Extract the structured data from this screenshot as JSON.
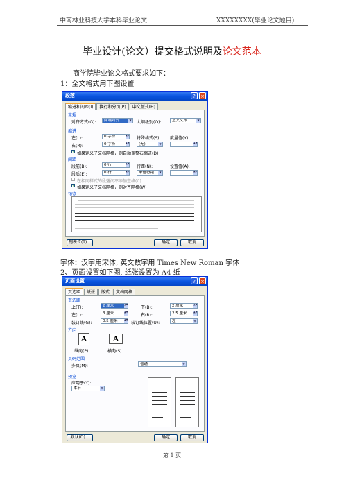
{
  "header": {
    "left": "中南林业科技大学本科毕业论文",
    "right": "XXXXXXXX(毕业论文题目)"
  },
  "title": {
    "main": "毕业设计(论文）提交格式说明及",
    "highlight": "论文范本"
  },
  "intro": "商学院毕业论文格式要求如下：",
  "item1": "1：全文格式用下图设置",
  "font_note": "字体：汉字用宋体, 英文数字用 Times New Roman 字体",
  "item2": "2、页面设置如下图, 纸张设置为 A4 纸",
  "dialog1": {
    "title": "段落",
    "tabs": [
      "缩进和间距(I)",
      "换行和分页(P)",
      "中文版式(H)"
    ],
    "sec_general": "常规",
    "align_label": "对齐方式(G):",
    "align_value": "两端对齐",
    "outline_label": "大纲级别(O):",
    "outline_value": "正文文本",
    "sec_indent": "缩进",
    "left_label": "左(L):",
    "left_value": "0 字符",
    "right_label": "右(R):",
    "right_value": "0 字符",
    "special_label": "特殊格式(S):",
    "special_value": "(无)",
    "degree_label": "度量值(Y):",
    "auto_indent": "如果定义了文档网格，则自动调整右缩进(D)",
    "sec_spacing": "间距",
    "before_label": "段前(B):",
    "before_value": "0 行",
    "after_label": "段后(E):",
    "after_value": "0 行",
    "line_label": "行距(N):",
    "line_value": "单倍行距",
    "setval_label": "设置值(A):",
    "no_space": "在相同样式的段落间不添加空格(C)",
    "snap_grid": "如果定义了文档网格，则对齐网格(W)",
    "sec_preview": "预览",
    "tabs_button": "制表位(T)...",
    "ok": "确定",
    "cancel": "取消"
  },
  "dialog2": {
    "title": "页面设置",
    "tabs": [
      "页边距",
      "纸张",
      "版式",
      "文档网格"
    ],
    "sec_margins": "页边距",
    "top_label": "上(T):",
    "top_value": "2 厘米",
    "bottom_label": "下(B):",
    "bottom_value": "2 厘米",
    "left_label": "左(L):",
    "left_value": "3 厘米",
    "right_label": "右(R):",
    "right_value": "2.5 厘米",
    "gutter_label": "装订线(G):",
    "gutter_value": "0.5 厘米",
    "gutterpos_label": "装订线位置(U):",
    "gutterpos_value": "左",
    "sec_orient": "方向",
    "portrait": "纵向(P)",
    "landscape": "横向(S)",
    "sec_pages": "页码范围",
    "multi_label": "多页(M):",
    "multi_value": "普通",
    "sec_preview": "预览",
    "apply_label": "应用于(Y):",
    "apply_value": "本节",
    "default_button": "默认(D)...",
    "ok": "确定",
    "cancel": "取消"
  },
  "footer": "第 1 页"
}
